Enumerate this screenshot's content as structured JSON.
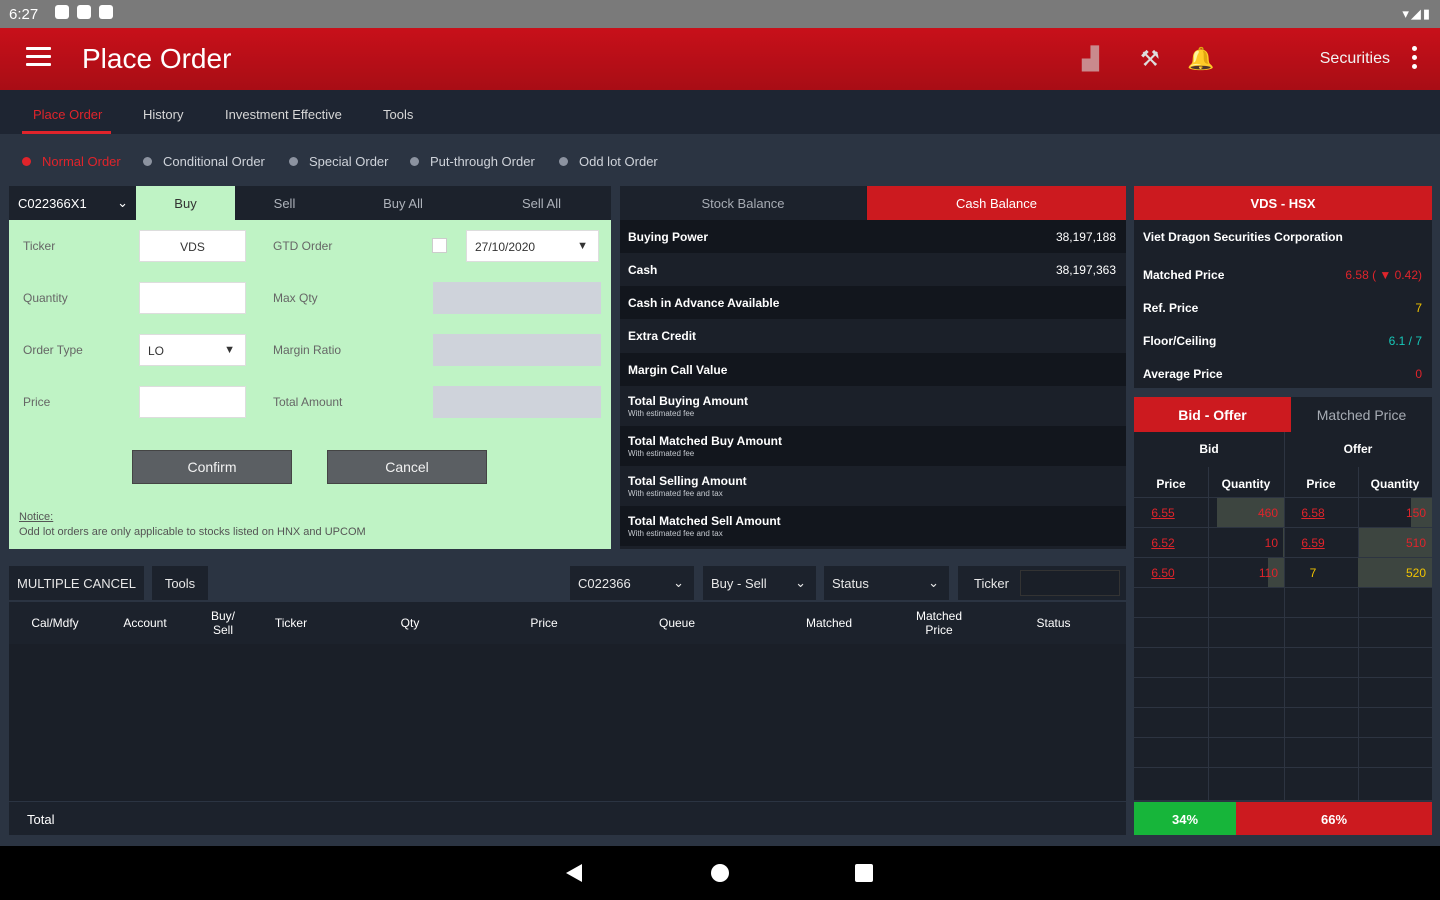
{
  "status_bar": {
    "time": "6:27"
  },
  "app_bar": {
    "title": "Place Order",
    "securities_label": "Securities"
  },
  "tabs": [
    {
      "label": "Place Order",
      "active": true
    },
    {
      "label": "History"
    },
    {
      "label": "Investment Effective"
    },
    {
      "label": "Tools"
    }
  ],
  "order_types": [
    {
      "label": "Normal Order",
      "active": true
    },
    {
      "label": "Conditional Order"
    },
    {
      "label": "Special Order"
    },
    {
      "label": "Put-through Order"
    },
    {
      "label": "Odd lot Order"
    }
  ],
  "order_panel": {
    "account": "C022366X1",
    "side_tabs": [
      "Buy",
      "Sell",
      "Buy All",
      "Sell All"
    ],
    "ticker_label": "Ticker",
    "ticker_value": "VDS",
    "gtd_label": "GTD Order",
    "gtd_date": "27/10/2020",
    "quantity_label": "Quantity",
    "maxqty_label": "Max Qty",
    "ordertype_label": "Order Type",
    "ordertype_value": "LO",
    "margin_label": "Margin Ratio",
    "price_label": "Price",
    "total_label": "Total Amount",
    "confirm_label": "Confirm",
    "cancel_label": "Cancel",
    "notice_title": "Notice:",
    "notice_text": "Odd lot orders are only applicable to stocks listed on HNX and UPCOM"
  },
  "balance": {
    "tabs": [
      "Stock Balance",
      "Cash Balance"
    ],
    "rows": [
      {
        "label": "Buying Power",
        "value": "38,197,188",
        "sub": ""
      },
      {
        "label": "Cash",
        "value": "38,197,363",
        "sub": ""
      },
      {
        "label": "Cash in Advance Available",
        "value": "",
        "sub": ""
      },
      {
        "label": "Extra Credit",
        "value": "",
        "sub": ""
      },
      {
        "label": "Margin Call Value",
        "value": "",
        "sub": ""
      },
      {
        "label": "Total Buying Amount",
        "value": "",
        "sub": "With estimated fee"
      },
      {
        "label": "Total Matched Buy Amount",
        "value": "",
        "sub": "With estimated fee"
      },
      {
        "label": "Total Selling Amount",
        "value": "",
        "sub": "With estimated fee and tax"
      },
      {
        "label": "Total Matched Sell Amount",
        "value": "",
        "sub": "With estimated fee and tax"
      }
    ]
  },
  "stock_info": {
    "header": "VDS - HSX",
    "company": "Viet Dragon Securities Corporation",
    "rows": [
      {
        "label": "Matched Price",
        "value": "6.58 ( ▼ 0.42)",
        "color": "#e0242b"
      },
      {
        "label": "Ref. Price",
        "value": "7",
        "color": "#f2c400"
      },
      {
        "label": "Floor/Ceiling",
        "value": "6.1 / 7",
        "color": "#16c7b8"
      },
      {
        "label": "Average Price",
        "value": "0",
        "color": "#e0242b"
      }
    ]
  },
  "bid_offer": {
    "tabs": [
      "Bid - Offer",
      "Matched Price"
    ],
    "group_headers": [
      "Bid",
      "Offer"
    ],
    "col_headers": [
      "Price",
      "Quantity",
      "Price",
      "Quantity"
    ],
    "rows": [
      {
        "bid_price": "6.55",
        "bid_qty": "460",
        "offer_price": "6.58",
        "offer_qty": "150"
      },
      {
        "bid_price": "6.52",
        "bid_qty": "10",
        "offer_price": "6.59",
        "offer_qty": "510"
      },
      {
        "bid_price": "6.50",
        "bid_qty": "110",
        "offer_price": "7",
        "offer_qty": "520"
      }
    ],
    "bid_pct": "34%",
    "offer_pct": "66%"
  },
  "order_list": {
    "multiple_cancel": "MULTIPLE CANCEL",
    "tools": "Tools",
    "account_filter": "C022366",
    "side_filter": "Buy - Sell",
    "status_filter": "Status",
    "ticker_filter": "Ticker",
    "headers": [
      "Cal/Mdfy",
      "Account",
      "Buy/\nSell",
      "Ticker",
      "Qty",
      "Price",
      "Queue",
      "Matched",
      "Matched\nPrice",
      "Status"
    ],
    "total_label": "Total"
  },
  "colors": {
    "brand_red": "#c8101a",
    "form_green": "#bff3c5",
    "bid_green": "#17b53a"
  }
}
